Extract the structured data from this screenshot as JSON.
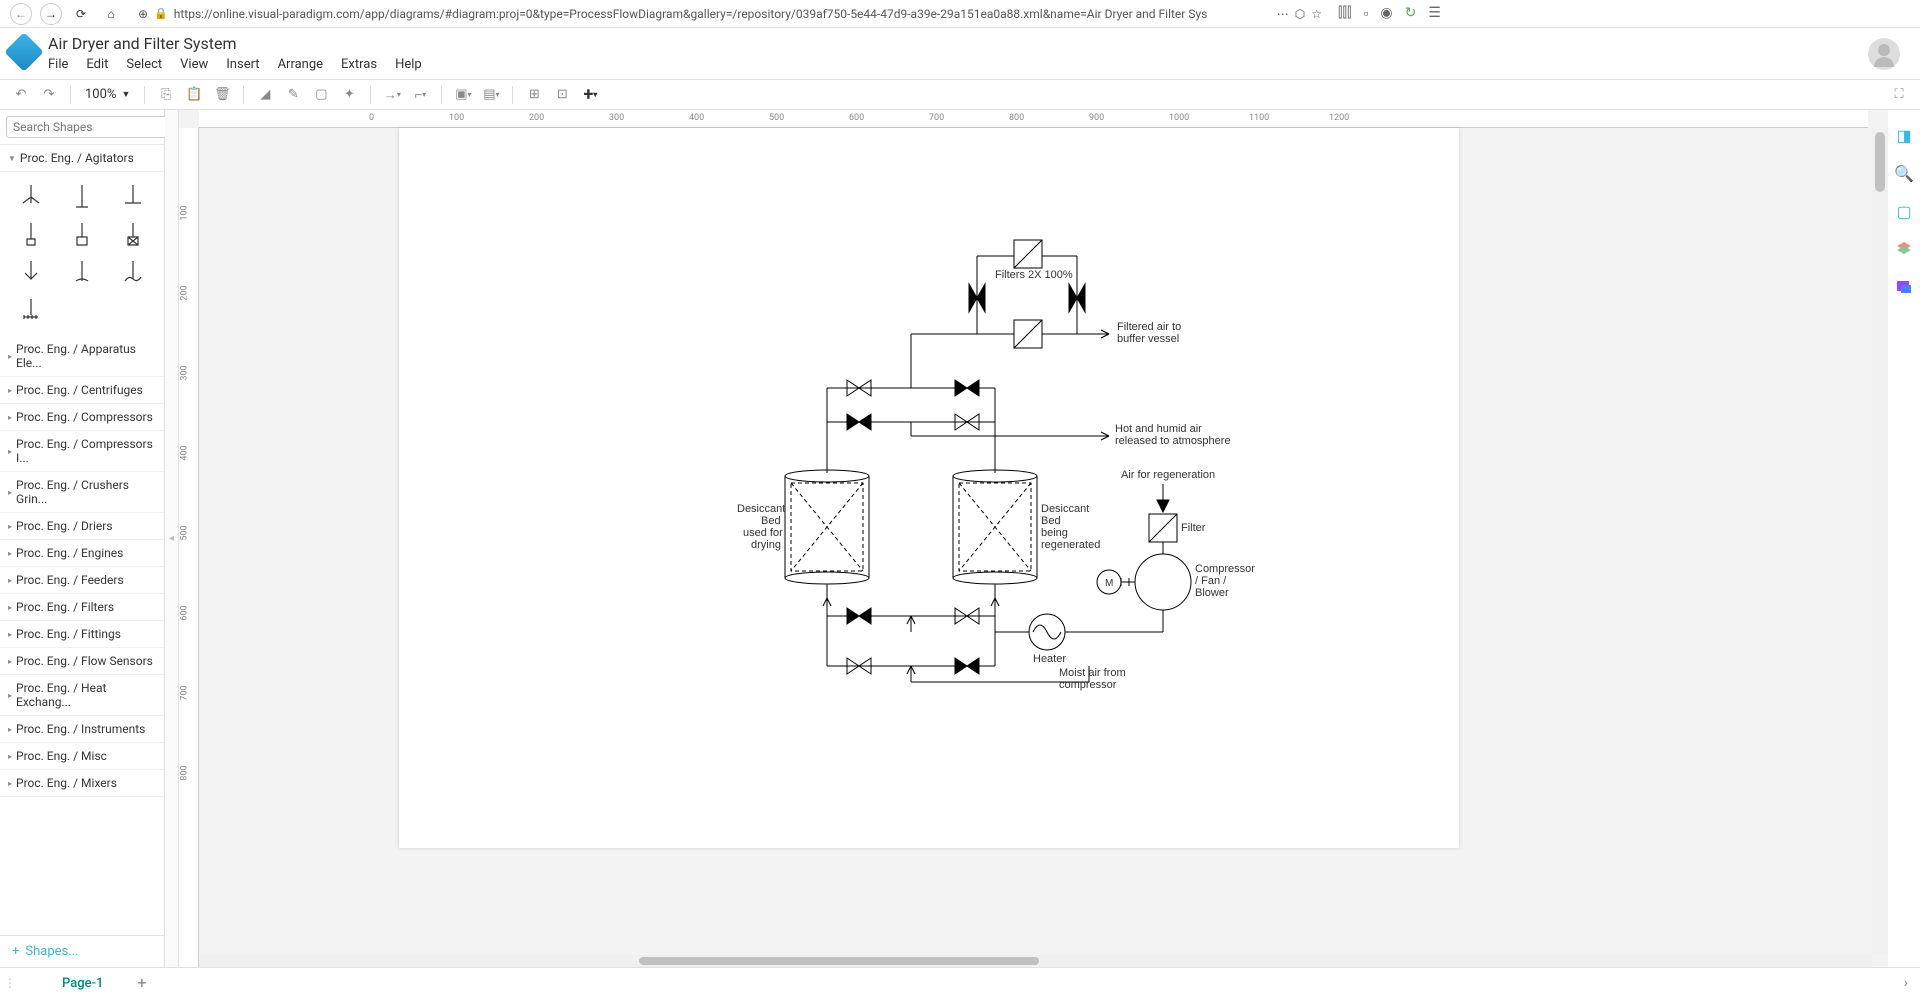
{
  "browser": {
    "url": "https://online.visual-paradigm.com/app/diagrams/#diagram:proj=0&type=ProcessFlowDiagram&gallery=/repository/039af750-5e44-47d9-a39e-29a151ea0a88.xml&name=Air Dryer and Filter Sys"
  },
  "doc": {
    "title": "Air Dryer and Filter System"
  },
  "menu": {
    "file": "File",
    "edit": "Edit",
    "select": "Select",
    "view": "View",
    "insert": "Insert",
    "arrange": "Arrange",
    "extras": "Extras",
    "help": "Help"
  },
  "toolbar": {
    "zoom": "100%"
  },
  "sidebar": {
    "search_placeholder": "Search Shapes",
    "expanded": "Proc. Eng. / Agitators",
    "cats": [
      "Proc. Eng. / Apparatus Ele...",
      "Proc. Eng. / Centrifuges",
      "Proc. Eng. / Compressors",
      "Proc. Eng. / Compressors I...",
      "Proc. Eng. / Crushers Grin...",
      "Proc. Eng. / Driers",
      "Proc. Eng. / Engines",
      "Proc. Eng. / Feeders",
      "Proc. Eng. / Filters",
      "Proc. Eng. / Fittings",
      "Proc. Eng. / Flow Sensors",
      "Proc. Eng. / Heat Exchang...",
      "Proc. Eng. / Instruments",
      "Proc. Eng. / Misc",
      "Proc. Eng. / Mixers"
    ],
    "shapes_btn": "Shapes..."
  },
  "ruler": {
    "h": [
      "0",
      "100",
      "200",
      "300",
      "400",
      "500",
      "600",
      "700",
      "800",
      "900",
      "1000",
      "1100",
      "1200"
    ],
    "v": [
      "100",
      "200",
      "300",
      "400",
      "500",
      "600",
      "700",
      "800"
    ]
  },
  "diagram": {
    "filters_label": "Filters 2X 100%",
    "filtered_air_l1": "Filtered air to",
    "filtered_air_l2": "buffer vessel",
    "hot_humid_l1": "Hot and humid air",
    "hot_humid_l2": "released to atmosphere",
    "bed1_l1": "Desiccant",
    "bed1_l2": "Bed",
    "bed1_l3": "used for",
    "bed1_l4": "drying",
    "bed2_l1": "Desiccant",
    "bed2_l2": "Bed",
    "bed2_l3": "being",
    "bed2_l4": "regenerated",
    "air_regen": "Air for regeneration",
    "filter_label": "Filter",
    "comp_l1": "Compressor",
    "comp_l2": "/ Fan /",
    "comp_l3": "Blower",
    "motor": "M",
    "heater": "Heater",
    "moist_l1": "Moist air from",
    "moist_l2": "compressor"
  },
  "tabs": {
    "page1": "Page-1"
  }
}
